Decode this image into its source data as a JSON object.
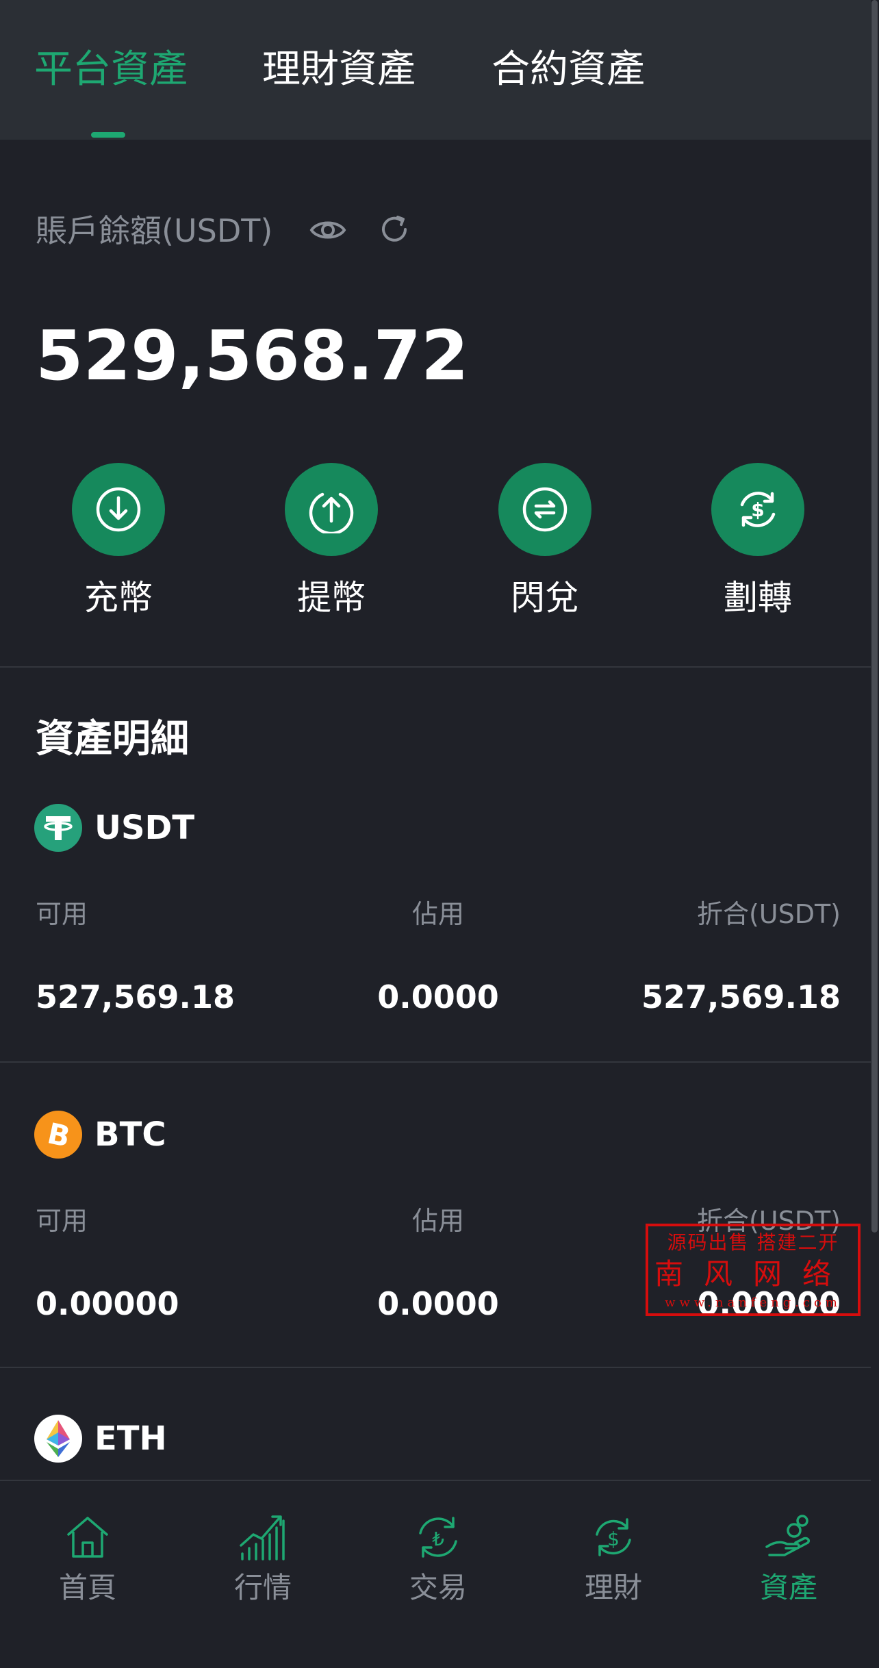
{
  "tabs": [
    {
      "label": "平台資產",
      "active": true
    },
    {
      "label": "理財資產",
      "active": false
    },
    {
      "label": "合約資產",
      "active": false
    }
  ],
  "balance": {
    "label": "賬戶餘額(USDT)",
    "value": "529,568.72",
    "icons": [
      "eye-icon",
      "refresh-icon"
    ]
  },
  "actions": [
    {
      "label": "充幣",
      "icon": "deposit-icon"
    },
    {
      "label": "提幣",
      "icon": "withdraw-icon"
    },
    {
      "label": "閃兌",
      "icon": "swap-icon"
    },
    {
      "label": "劃轉",
      "icon": "transfer-icon"
    }
  ],
  "assets_section": {
    "title": "資產明細",
    "columns": [
      "可用",
      "佔用",
      "折合(USDT)"
    ],
    "items": [
      {
        "name": "USDT",
        "available": "527,569.18",
        "occupied": "0.0000",
        "converted": "527,569.18",
        "icon": "usdt-logo"
      },
      {
        "name": "BTC",
        "available": "0.00000",
        "occupied": "0.0000",
        "converted": "0.00000",
        "icon": "btc-logo"
      },
      {
        "name": "ETH",
        "icon": "eth-logo"
      }
    ]
  },
  "watermark": {
    "line1": "源码出售 搭建二开",
    "line2": "南风网络",
    "line3": "www.nanfeng.com"
  },
  "nav": [
    {
      "label": "首頁",
      "icon": "home-icon",
      "active": false
    },
    {
      "label": "行情",
      "icon": "market-chart-icon",
      "active": false
    },
    {
      "label": "交易",
      "icon": "trade-icon",
      "active": false
    },
    {
      "label": "理財",
      "icon": "finance-icon",
      "active": false
    },
    {
      "label": "資產",
      "icon": "assets-icon",
      "active": true
    }
  ],
  "colors": {
    "accent": "#1ea872",
    "action_circle": "#16895c",
    "background": "#1f2128",
    "header": "#2b2f35",
    "muted_text": "#8a8f98",
    "btc": "#f7931a",
    "usdt": "#26a17b",
    "watermark": "#d60d0d"
  }
}
